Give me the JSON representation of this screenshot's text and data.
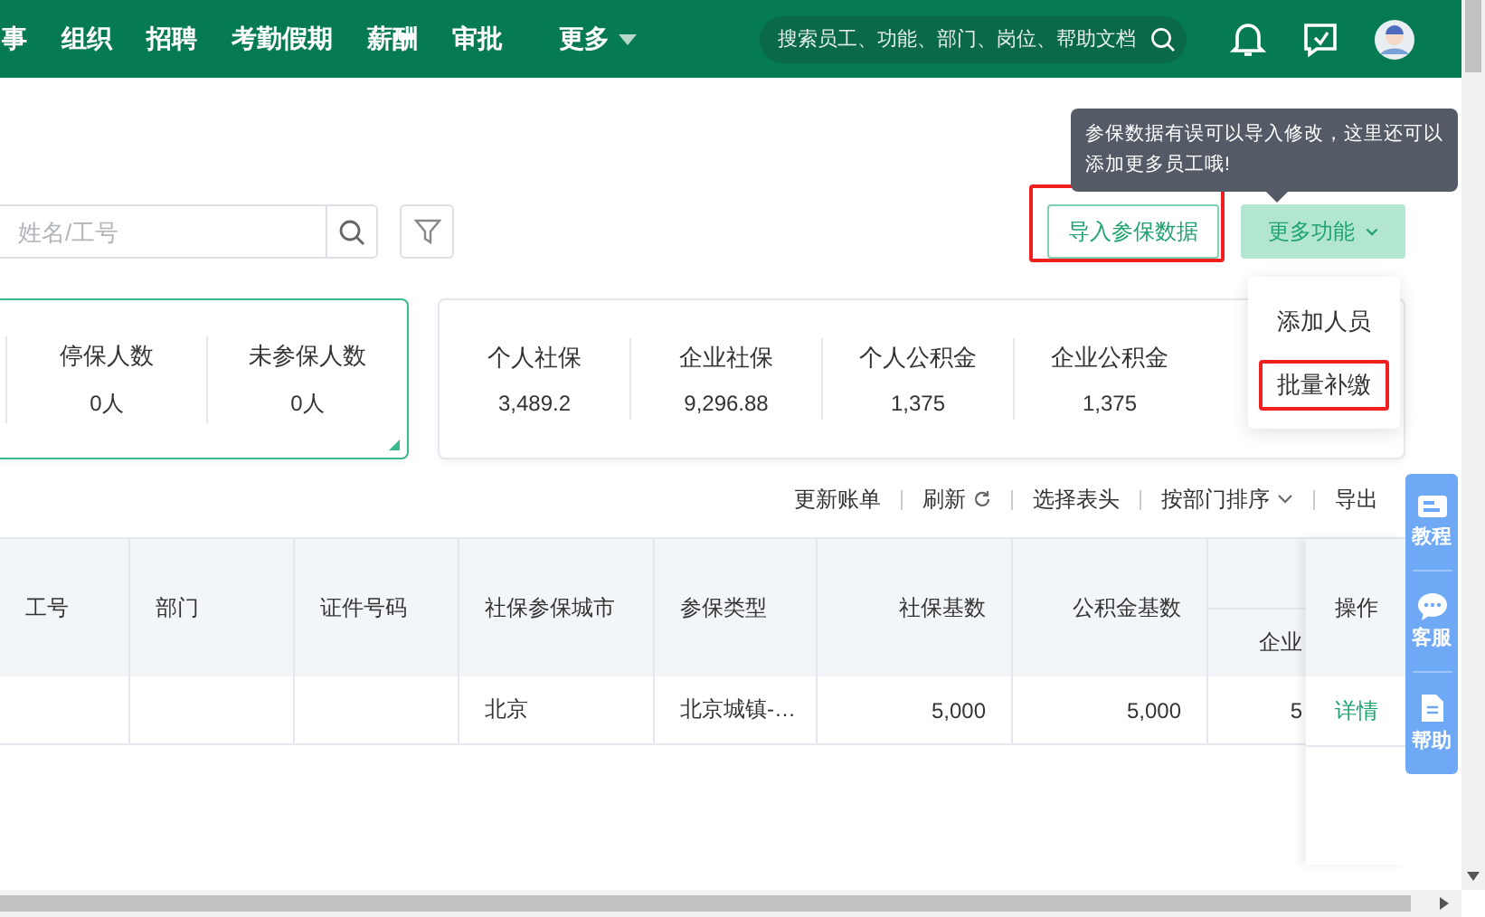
{
  "nav": {
    "items": [
      {
        "label": "事"
      },
      {
        "label": "组织"
      },
      {
        "label": "招聘"
      },
      {
        "label": "考勤假期"
      },
      {
        "label": "薪酬"
      },
      {
        "label": "审批"
      }
    ],
    "more": "更多",
    "search_placeholder": "搜索员工、功能、部门、岗位、帮助文档"
  },
  "tooltip": {
    "text": "参保数据有误可以导入修改，这里还可以添加更多员工哦!"
  },
  "search": {
    "placeholder": "姓名/工号"
  },
  "actions": [
    {
      "label": "导入参保数据",
      "kind": "outline",
      "highlighted": true
    },
    {
      "label": "更多功能",
      "kind": "dropdown",
      "highlighted": false
    }
  ],
  "dropdown": {
    "items": [
      {
        "label": "添加人员",
        "highlighted": false
      },
      {
        "label": "批量补缴",
        "highlighted": true
      }
    ]
  },
  "cards": [
    {
      "selected": true,
      "stats": [
        {
          "label": "停保人数",
          "value": "0人"
        },
        {
          "label": "未参保人数",
          "value": "0人"
        }
      ]
    },
    {
      "selected": false,
      "stats": [
        {
          "label": "个人社保",
          "value": "3,489.2"
        },
        {
          "label": "企业社保",
          "value": "9,296.88"
        },
        {
          "label": "个人公积金",
          "value": "1,375"
        },
        {
          "label": "企业公积金",
          "value": "1,375"
        }
      ]
    }
  ],
  "toolbar": [
    {
      "label": "更新账单",
      "kind": "plain"
    },
    {
      "label": "刷新",
      "kind": "refresh"
    },
    {
      "label": "选择表头",
      "kind": "plain"
    },
    {
      "label": "按部门排序",
      "kind": "sort"
    },
    {
      "label": "导出",
      "kind": "plain"
    }
  ],
  "table": {
    "columns": [
      {
        "label": "工号"
      },
      {
        "label": "部门"
      },
      {
        "label": "证件号码"
      },
      {
        "label": "社保参保城市"
      },
      {
        "label": "参保类型"
      },
      {
        "label": "社保基数"
      },
      {
        "label": "公积金基数"
      }
    ],
    "column_8_subheader": "企业",
    "action_column": "操作",
    "rows": [
      {
        "cells": [
          "",
          "",
          "",
          "北京",
          "北京城镇-…",
          "5,000",
          "5,000"
        ],
        "column_8": "5",
        "action": "详情"
      }
    ]
  },
  "side_panel": [
    {
      "label": "教程",
      "kind": "tutorial"
    },
    {
      "label": "客服",
      "kind": "service"
    },
    {
      "label": "帮助",
      "kind": "help"
    }
  ]
}
